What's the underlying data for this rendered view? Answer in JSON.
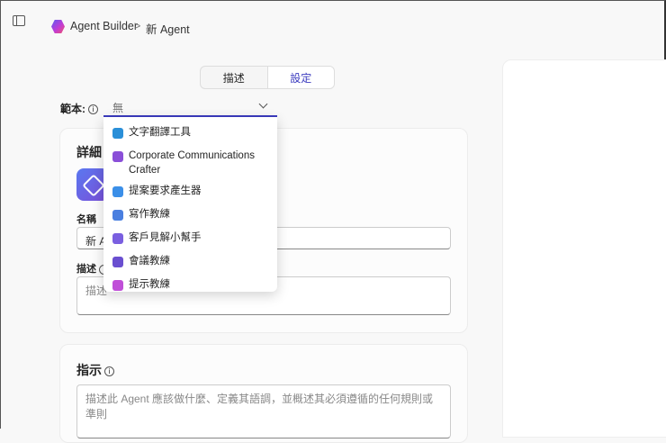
{
  "header": {
    "app": "Agent Builder",
    "separator": ">",
    "page": "新 Agent"
  },
  "tabs": [
    {
      "label": "描述",
      "selected": false
    },
    {
      "label": "設定",
      "selected": true
    }
  ],
  "template": {
    "label": "範本:",
    "value": "無"
  },
  "details": {
    "title": "詳細",
    "name_label": "名稱",
    "name_value": "新 Agent",
    "desc_label": "描述",
    "desc_placeholder": "描述"
  },
  "instructions": {
    "title": "指示",
    "placeholder": "描述此 Agent 應該做什麼、定義其語調，並概述其必須遵循的任何規則或準則"
  },
  "dropdown": [
    {
      "label": "文字翻譯工具",
      "color": "#2a8fd8"
    },
    {
      "label": "Corporate Communications Crafter",
      "color": "#8a4fd8"
    },
    {
      "label": "提案要求產生器",
      "color": "#3b8fe8"
    },
    {
      "label": "寫作教練",
      "color": "#4a7fe0"
    },
    {
      "label": "客戶見解小幫手",
      "color": "#7a5fe0"
    },
    {
      "label": "會議教練",
      "color": "#6a4fd0"
    },
    {
      "label": "提示教練",
      "color": "#c04fd8"
    }
  ],
  "info_glyph": "i"
}
